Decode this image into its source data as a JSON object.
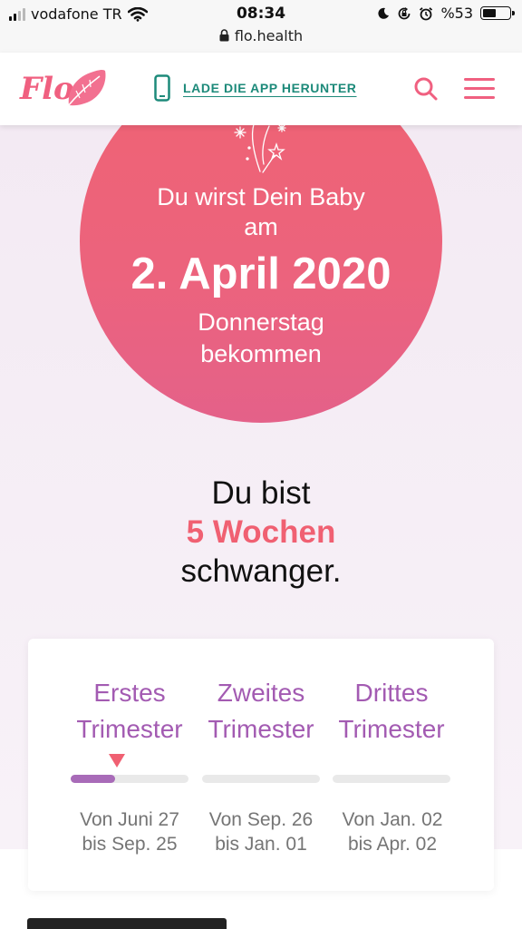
{
  "status_bar": {
    "carrier": "vodafone TR",
    "time": "08:34",
    "battery": "%53",
    "battery_level": 0.53
  },
  "browser": {
    "url": "flo.health"
  },
  "header": {
    "logo_text": "Flo",
    "download_label": "LADE DIE APP HERUNTER"
  },
  "due_date": {
    "line1": "Du wirst Dein Baby",
    "line2": "am",
    "date": "2. April 2020",
    "weekday": "Donnerstag",
    "ending": "bekommen"
  },
  "pregnancy": {
    "line1": "Du bist",
    "weeks": "5 Wochen",
    "line3": "schwanger."
  },
  "trimesters": [
    {
      "name_1": "Erstes",
      "name_2": "Trimester",
      "range_1": "Von Juni 27",
      "range_2": "bis Sep. 25",
      "progress": 0.38,
      "current": true
    },
    {
      "name_1": "Zweites",
      "name_2": "Trimester",
      "range_1": "Von Sep. 26",
      "range_2": "bis Jan. 01",
      "progress": 0,
      "current": false
    },
    {
      "name_1": "Drittes",
      "name_2": "Trimester",
      "range_1": "Von Jan. 02",
      "range_2": "bis Apr. 02",
      "progress": 0,
      "current": false
    }
  ],
  "colors": {
    "brand_pink": "#f06080",
    "teal": "#1d8a7a",
    "purple": "#a35bb2"
  }
}
